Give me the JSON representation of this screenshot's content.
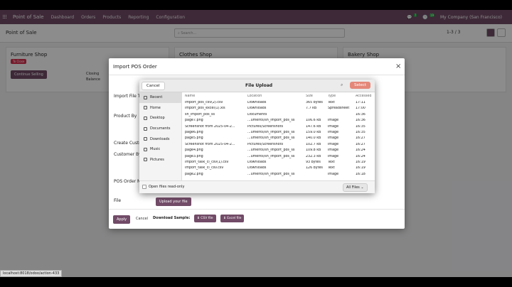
{
  "topnav": {
    "app_title": "Point of Sale",
    "menu": [
      "Dashboard",
      "Orders",
      "Products",
      "Reporting",
      "Configuration"
    ],
    "chat_count": "7",
    "activity_count": "19",
    "company": "My Company (San Francisco)"
  },
  "control_bar": {
    "title": "Point of Sale",
    "search_placeholder": "Search...",
    "pager": "1-3 / 3"
  },
  "kanban": [
    {
      "name": "Furniture Shop",
      "tag": "To Close",
      "button": "Continue Selling",
      "closing_label": "Closing",
      "balance_label": "Balance"
    },
    {
      "name": "Clothes Shop"
    },
    {
      "name": "Bakery Shop"
    }
  ],
  "modal": {
    "title": "Import POS Order",
    "close": "×",
    "labels": {
      "import_file": "Import File T",
      "product_by": "Product By",
      "create_customer": "Create Custo",
      "customer_by": "Customer By",
      "pos_order": "POS Order N",
      "file": "File"
    },
    "upload_button": "Upload your file",
    "footer": {
      "apply": "Apply",
      "cancel": "Cancel",
      "download_sample": "Download Sample:",
      "csv": "CSV file",
      "excel": "Excel file"
    }
  },
  "file_dialog": {
    "title": "File Upload",
    "cancel": "Cancel",
    "select": "Select",
    "sidebar": [
      "Recent",
      "Home",
      "Desktop",
      "Documents",
      "Downloads",
      "Music",
      "Pictures"
    ],
    "columns": {
      "name": "Name",
      "location": "Location",
      "size": "Size",
      "type": "Type",
      "accessed": "Accessed"
    },
    "files": [
      {
        "name": "import_pos_csv(2).csv",
        "location": "Downloads",
        "size": "365 bytes",
        "type": "Text",
        "accessed": "17:11"
      },
      {
        "name": "import_pos_excel(1).xls",
        "location": "Downloads",
        "size": "7.7 kB",
        "type": "Spreadsheet",
        "accessed": "17:00"
      },
      {
        "name": "sh_import_pos_ss",
        "location": "Documents",
        "size": "",
        "type": "",
        "accessed": "16:36"
      },
      {
        "name": "page7.png",
        "location": "...uments/sh_import_pos_ss",
        "size": "106.6 kB",
        "type": "Image",
        "accessed": "16:36"
      },
      {
        "name": "Screenshot from 2025-04-2...",
        "location": "Pictures/Screenshots",
        "size": "147.6 kB",
        "type": "Image",
        "accessed": "16:35"
      },
      {
        "name": "page6.png",
        "location": "...uments/sh_import_pos_ss",
        "size": "159.0 kB",
        "type": "Image",
        "accessed": "16:35"
      },
      {
        "name": "page5.png",
        "location": "...uments/sh_import_pos_ss",
        "size": "140.0 kB",
        "type": "Image",
        "accessed": "16:27"
      },
      {
        "name": "Screenshot from 2025-04-2...",
        "location": "Pictures/Screenshots",
        "size": "102.7 kB",
        "type": "Image",
        "accessed": "16:27"
      },
      {
        "name": "page4.png",
        "location": "...uments/sh_import_pos_ss",
        "size": "109.8 kB",
        "type": "Image",
        "accessed": "16:24"
      },
      {
        "name": "page3.png",
        "location": "...uments/sh_import_pos_ss",
        "size": "232.3 kB",
        "type": "Image",
        "accessed": "16:24"
      },
      {
        "name": "import_task_cl_csv(1).csv",
        "location": "Downloads",
        "size": "93 bytes",
        "type": "Text",
        "accessed": "16:19"
      },
      {
        "name": "import_task_cl_csv.csv",
        "location": "Downloads",
        "size": "126 bytes",
        "type": "Text",
        "accessed": "16:19"
      },
      {
        "name": "page2.png",
        "location": "...uments/sh_import_pos_ss",
        "size": "",
        "type": "Image",
        "accessed": "16:18"
      }
    ],
    "read_only_label": "Open files read-only",
    "filter": "All Files"
  },
  "statusbar": "localhost:8018/odoo/action-433",
  "colors": {
    "brand": "#714b67",
    "accent": "#e4887a",
    "tag": "#d9314f"
  }
}
